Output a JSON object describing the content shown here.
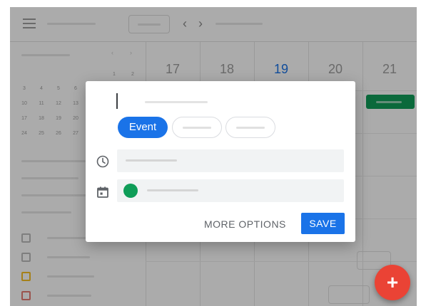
{
  "header": {
    "menu_icon": "hamburger-menu-icon",
    "prev_icon": "chevron-left-icon",
    "next_icon": "chevron-right-icon",
    "prev_glyph": "‹",
    "next_glyph": "›"
  },
  "mini_calendar": {
    "arrows": [
      "‹",
      "›"
    ],
    "first_row": [
      "1",
      "2"
    ],
    "weeks": [
      [
        "3",
        "4",
        "5",
        "6"
      ],
      [
        "10",
        "11",
        "12",
        "13"
      ],
      [
        "17",
        "18",
        "19",
        "20"
      ],
      [
        "24",
        "25",
        "26",
        "27"
      ]
    ]
  },
  "grid": {
    "days": [
      "17",
      "18",
      "19",
      "20",
      "21"
    ],
    "today": "19"
  },
  "dialog": {
    "chips": {
      "event_label": "Event"
    },
    "time_icon": "clock-icon",
    "calendar_icon": "calendar-icon",
    "calendar_color": "#0f9d58",
    "more_options_label": "MORE OPTIONS",
    "save_label": "SAVE"
  },
  "fab": {
    "icon": "plus-icon",
    "glyph": "+",
    "color": "#ea4335"
  },
  "colors": {
    "accent": "#1a73e8",
    "event_green": "#0f9d58",
    "fab_red": "#ea4335"
  }
}
